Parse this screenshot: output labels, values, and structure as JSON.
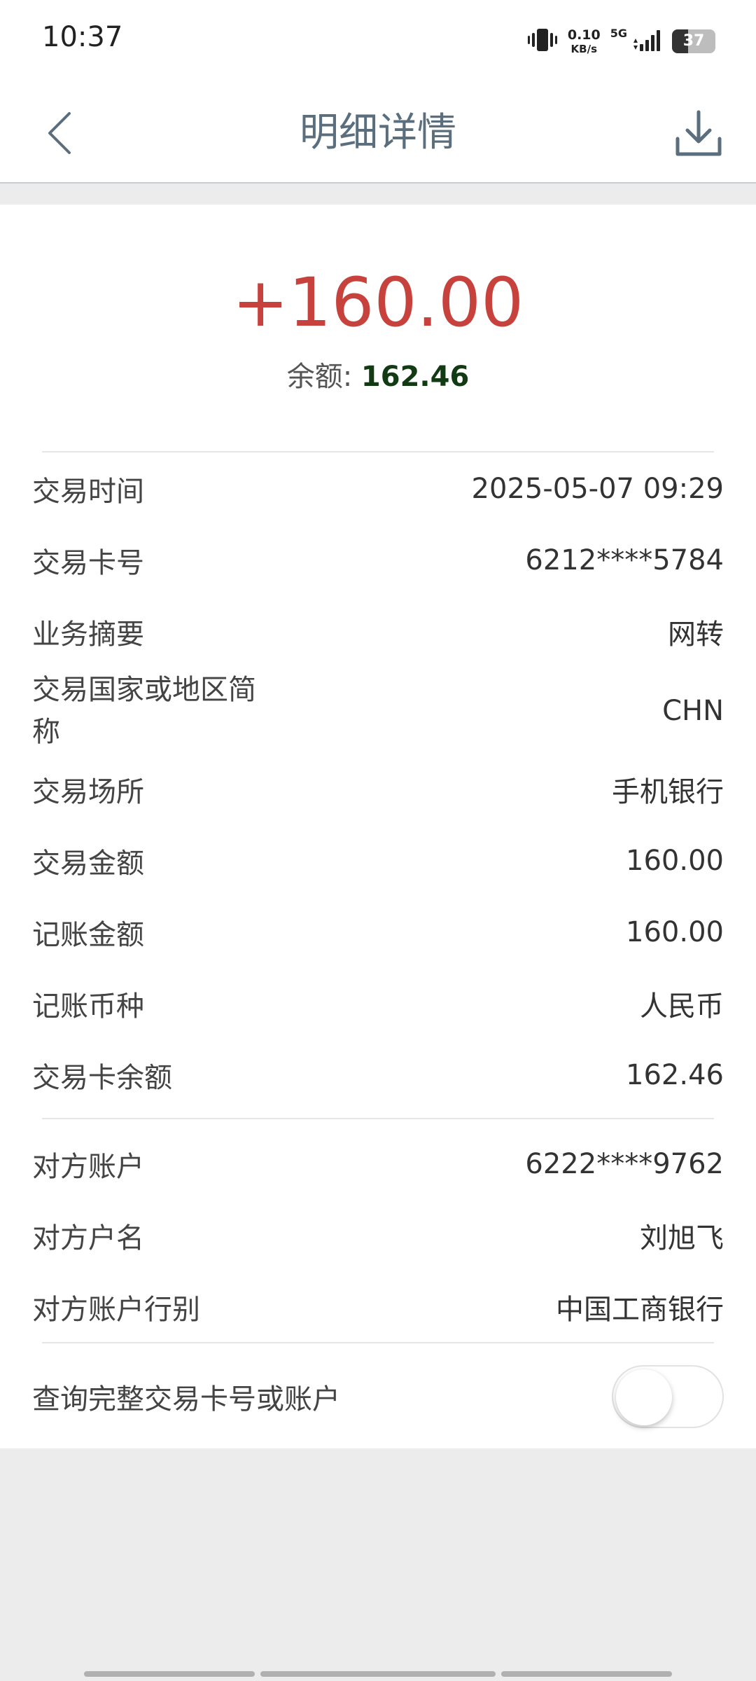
{
  "status_bar": {
    "time": "10:37",
    "net_speed_value": "0.10",
    "net_speed_unit": "KB/s",
    "network_type": "5G",
    "battery": "37"
  },
  "nav": {
    "title": "明细详情",
    "back_icon": "chevron-left-icon",
    "download_icon": "download-icon"
  },
  "summary": {
    "amount": "+160.00",
    "balance_label": "余额: ",
    "balance_value": "162.46"
  },
  "details": [
    {
      "label": "交易时间",
      "value": "2025-05-07 09:29"
    },
    {
      "label": "交易卡号",
      "value": "6212****5784"
    },
    {
      "label": "业务摘要",
      "value": "网转"
    },
    {
      "label": "交易国家或地区简称",
      "value": "CHN"
    },
    {
      "label": "交易场所",
      "value": "手机银行"
    },
    {
      "label": "交易金额",
      "value": "160.00"
    },
    {
      "label": "记账金额",
      "value": "160.00"
    },
    {
      "label": "记账币种",
      "value": "人民币"
    },
    {
      "label": "交易卡余额",
      "value": "162.46"
    }
  ],
  "counterparty": [
    {
      "label": "对方账户",
      "value": "6222****9762"
    },
    {
      "label": "对方户名",
      "value": "刘旭飞"
    },
    {
      "label": "对方账户行别",
      "value": "中国工商银行"
    }
  ],
  "toggle": {
    "label": "查询完整交易卡号或账户",
    "on": false
  },
  "colors": {
    "amount": "#c8423d",
    "balance": "#123b14",
    "title": "#5a6e7d"
  }
}
